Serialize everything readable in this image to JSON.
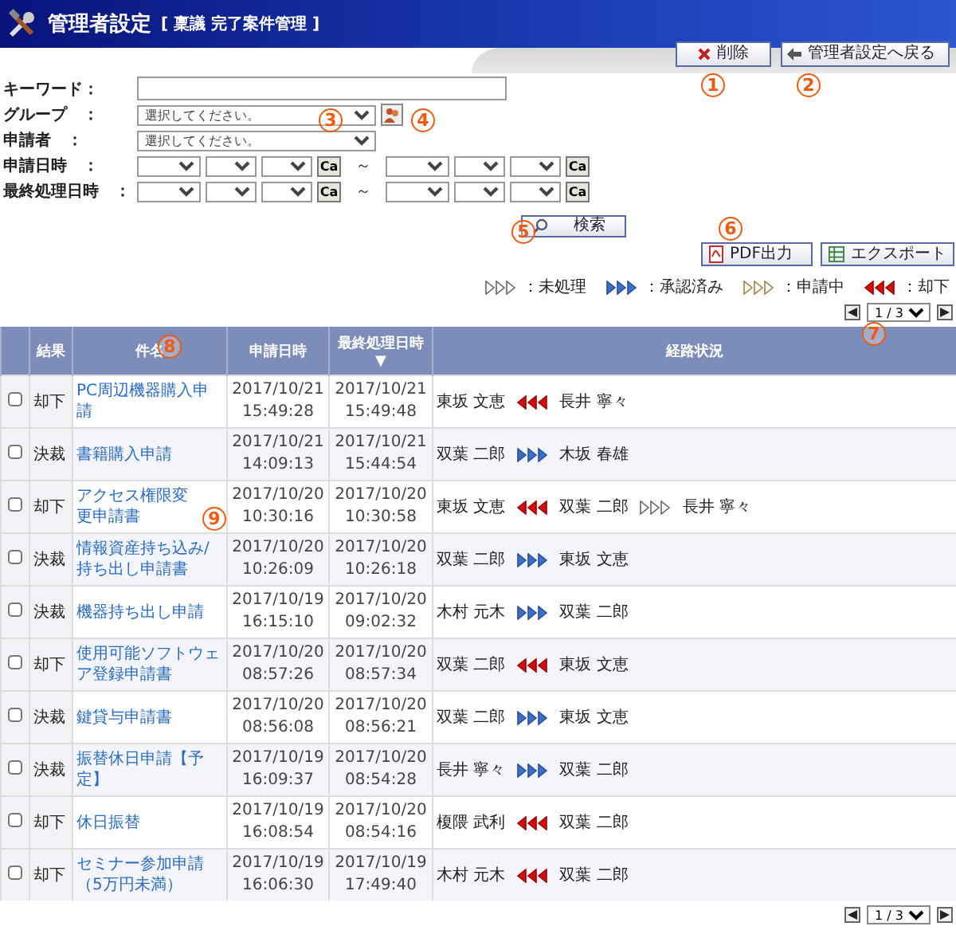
{
  "header": {
    "title": "管理者設定",
    "subtitle": "[ 稟議 完了案件管理 ]"
  },
  "top_buttons": [
    {
      "kind": "delete",
      "label": "削除"
    },
    {
      "kind": "back",
      "label": "管理者設定へ戻る"
    }
  ],
  "form": {
    "keyword": {
      "label": "キーワード："
    },
    "group": {
      "label": "グループ　：",
      "value": "選択してください。"
    },
    "applicant": {
      "label": "申請者　：",
      "value": "選択してください。"
    },
    "date_rows": [
      {
        "label": "申請日時　：",
        "calendar_buttons": [
          "Ca",
          "Ca"
        ],
        "separator": "～"
      },
      {
        "label": "最終処理日時　：",
        "calendar_buttons": [
          "Ca",
          "Ca"
        ],
        "separator": "～"
      }
    ]
  },
  "search_button": "検索",
  "output_buttons": [
    {
      "kind": "pdf",
      "label": "PDF出力"
    },
    {
      "kind": "export",
      "label": "エクスポート"
    }
  ],
  "legend": [
    {
      "kind": "pending",
      "label": "：未処理"
    },
    {
      "kind": "approved",
      "label": "：承認済み"
    },
    {
      "kind": "in_progress",
      "label": "：申請中"
    },
    {
      "kind": "rejected",
      "label": "：却下"
    }
  ],
  "pager_top": {
    "page": "1 / 3"
  },
  "table": {
    "columns": [
      "結果",
      "件名",
      "申請日時",
      "最終処理日時",
      "経路状況"
    ],
    "sort_mark": "▼",
    "rows": [
      {
        "checked": false,
        "result": "却下",
        "subject": "PC周辺機器購入申請",
        "applied": "2017/10/21\n15:49:28",
        "last": "2017/10/21\n15:49:48",
        "route": [
          {
            "name": "東坂 文恵",
            "kind": "rejected"
          },
          {
            "name": "長井 寧々",
            "kind": "end"
          }
        ]
      },
      {
        "checked": false,
        "result": "決裁",
        "subject": "書籍購入申請",
        "applied": "2017/10/21\n14:09:13",
        "last": "2017/10/21\n15:44:54",
        "route": [
          {
            "name": "双葉 二郎",
            "kind": "approved"
          },
          {
            "name": "木坂 春雄",
            "kind": "end"
          }
        ]
      },
      {
        "checked": false,
        "result": "却下",
        "subject": "アクセス権限変更申請書",
        "applied": "2017/10/20\n10:30:16",
        "last": "2017/10/20\n10:30:58",
        "route": [
          {
            "name": "東坂 文恵",
            "kind": "rejected"
          },
          {
            "name": "双葉 二郎",
            "kind": "pending"
          },
          {
            "name": "長井 寧々",
            "kind": "end"
          }
        ]
      },
      {
        "checked": false,
        "result": "決裁",
        "subject": "情報資産持ち込み/持ち出し申請書",
        "applied": "2017/10/20\n10:26:09",
        "last": "2017/10/20\n10:26:18",
        "route": [
          {
            "name": "双葉 二郎",
            "kind": "approved"
          },
          {
            "name": "東坂 文恵",
            "kind": "end"
          }
        ]
      },
      {
        "checked": false,
        "result": "決裁",
        "subject": "機器持ち出し申請",
        "applied": "2017/10/19\n16:15:10",
        "last": "2017/10/20\n09:02:32",
        "route": [
          {
            "name": "木村 元木",
            "kind": "approved"
          },
          {
            "name": "双葉 二郎",
            "kind": "end"
          }
        ]
      },
      {
        "checked": false,
        "result": "却下",
        "subject": "使用可能ソフトウェア登録申請書",
        "applied": "2017/10/20\n08:57:26",
        "last": "2017/10/20\n08:57:34",
        "route": [
          {
            "name": "双葉 二郎",
            "kind": "rejected"
          },
          {
            "name": "東坂 文恵",
            "kind": "end"
          }
        ]
      },
      {
        "checked": false,
        "result": "決裁",
        "subject": "鍵貸与申請書",
        "applied": "2017/10/20\n08:56:08",
        "last": "2017/10/20\n08:56:21",
        "route": [
          {
            "name": "双葉 二郎",
            "kind": "approved"
          },
          {
            "name": "東坂 文恵",
            "kind": "end"
          }
        ]
      },
      {
        "checked": false,
        "result": "決裁",
        "subject": "振替休日申請【予定】",
        "applied": "2017/10/19\n16:09:37",
        "last": "2017/10/20\n08:54:28",
        "route": [
          {
            "name": "長井 寧々",
            "kind": "approved"
          },
          {
            "name": "双葉 二郎",
            "kind": "end"
          }
        ]
      },
      {
        "checked": false,
        "result": "却下",
        "subject": "休日振替",
        "applied": "2017/10/19\n16:08:54",
        "last": "2017/10/20\n08:54:16",
        "route": [
          {
            "name": "榎隈 武利",
            "kind": "rejected"
          },
          {
            "name": "双葉 二郎",
            "kind": "end"
          }
        ]
      },
      {
        "checked": false,
        "result": "却下",
        "subject": "セミナー参加申請（5万円未満）",
        "applied": "2017/10/19\n16:06:30",
        "last": "2017/10/19\n17:49:40",
        "route": [
          {
            "name": "木村 元木",
            "kind": "rejected"
          },
          {
            "name": "双葉 二郎",
            "kind": "end"
          }
        ]
      }
    ]
  },
  "pager_bottom": {
    "page": "1 / 3"
  },
  "callouts": [
    "1",
    "2",
    "3",
    "4",
    "5",
    "6",
    "7",
    "8",
    "9"
  ]
}
